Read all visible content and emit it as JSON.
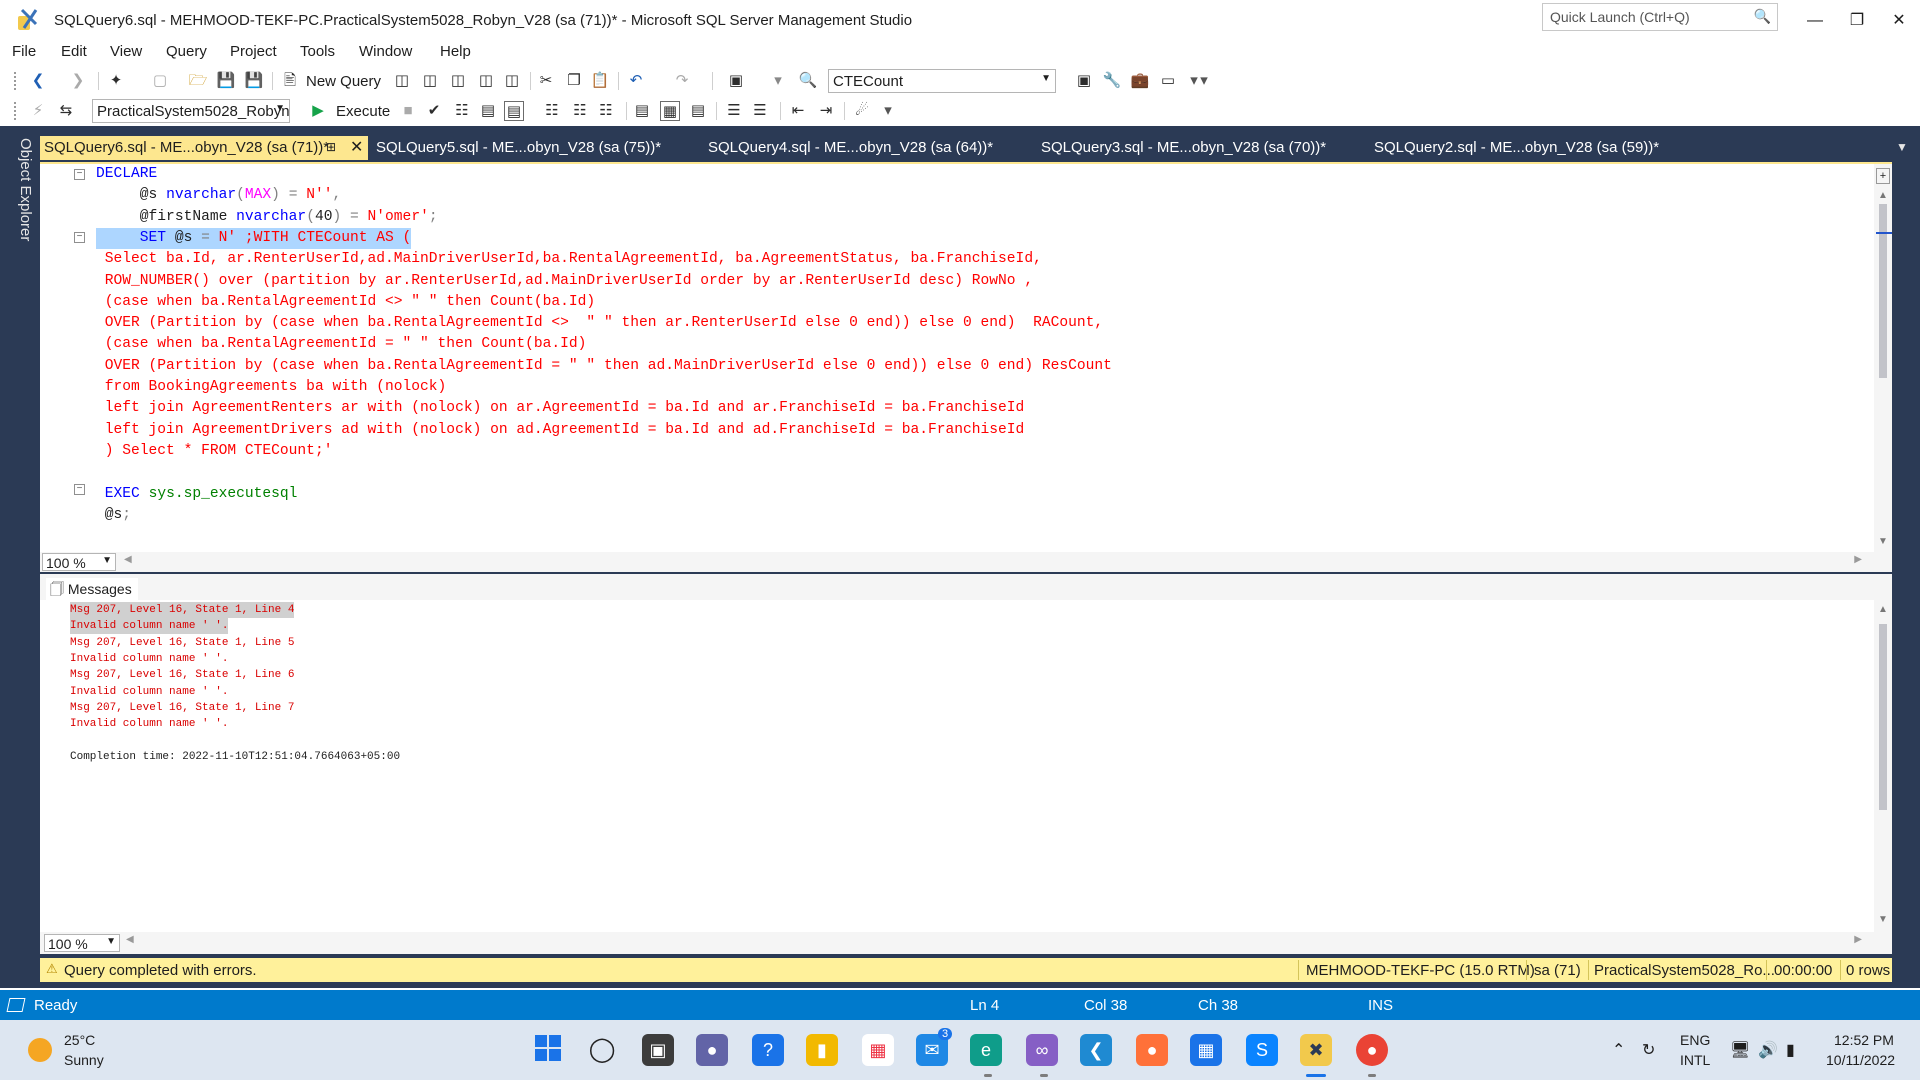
{
  "window": {
    "title": "SQLQuery6.sql - MEHMOOD-TEKF-PC.PracticalSystem5028_Robyn_V28 (sa (71))* - Microsoft SQL Server Management Studio",
    "quick_launch_placeholder": "Quick Launch (Ctrl+Q)",
    "icons": [
      "ssms-app-icon",
      "search-icon",
      "minimize-icon",
      "restore-icon",
      "close-icon"
    ]
  },
  "menu": [
    "File",
    "Edit",
    "View",
    "Query",
    "Project",
    "Tools",
    "Window",
    "Help"
  ],
  "toolbar1": {
    "new_query_label": "New Query",
    "find_combo_value": "CTECount"
  },
  "toolbar2": {
    "database_value": "PracticalSystem5028_Robyn",
    "execute_label": "Execute"
  },
  "side_panel": {
    "object_explorer_label": "Object Explorer"
  },
  "tabs": [
    {
      "label": "SQLQuery6.sql - ME...obyn_V28 (sa (71))*",
      "active": true
    },
    {
      "label": "SQLQuery5.sql - ME...obyn_V28 (sa (75))*",
      "active": false
    },
    {
      "label": "SQLQuery4.sql - ME...obyn_V28 (sa (64))*",
      "active": false
    },
    {
      "label": "SQLQuery3.sql - ME...obyn_V28 (sa (70))*",
      "active": false
    },
    {
      "label": "SQLQuery2.sql - ME...obyn_V28 (sa (59))*",
      "active": false
    }
  ],
  "editor": {
    "zoom": "100 %",
    "lines": [
      [
        [
          "kw",
          "DECLARE"
        ]
      ],
      [
        [
          "pl",
          "     @s "
        ],
        [
          "kw",
          "nvarchar"
        ],
        [
          "op",
          "("
        ],
        [
          "fn",
          "MAX"
        ],
        [
          "op",
          ")"
        ],
        [
          "pl",
          " "
        ],
        [
          "op",
          "="
        ],
        [
          "pl",
          " "
        ],
        [
          "str",
          "N''"
        ],
        [
          "op",
          ","
        ]
      ],
      [
        [
          "pl",
          "     @firstName "
        ],
        [
          "kw",
          "nvarchar"
        ],
        [
          "op",
          "("
        ],
        [
          "pl",
          "40"
        ],
        [
          "op",
          ")"
        ],
        [
          "pl",
          " "
        ],
        [
          "op",
          "="
        ],
        [
          "pl",
          " "
        ],
        [
          "str",
          "N'omer'"
        ],
        [
          "op",
          ";"
        ]
      ],
      [
        [
          "kw",
          "     SET"
        ],
        [
          "pl",
          " @s "
        ],
        [
          "op",
          "="
        ],
        [
          "pl",
          " "
        ],
        [
          "str",
          "N' ;WITH CTECount AS ("
        ]
      ],
      [
        [
          "str",
          " Select ba.Id, ar.RenterUserId,ad.MainDriverUserId,ba.RentalAgreementId, ba.AgreementStatus, ba.FranchiseId,"
        ]
      ],
      [
        [
          "str",
          " ROW_NUMBER() over (partition by ar.RenterUserId,ad.MainDriverUserId order by ar.RenterUserId desc) RowNo ,"
        ]
      ],
      [
        [
          "str",
          " (case when ba.RentalAgreementId <> \" \" then Count(ba.Id)"
        ]
      ],
      [
        [
          "str",
          " OVER (Partition by (case when ba.RentalAgreementId <>  \" \" then ar.RenterUserId else 0 end)) else 0 end)  RACount,"
        ]
      ],
      [
        [
          "str",
          " (case when ba.RentalAgreementId = \" \" then Count(ba.Id)"
        ]
      ],
      [
        [
          "str",
          " OVER (Partition by (case when ba.RentalAgreementId = \" \" then ad.MainDriverUserId else 0 end)) else 0 end) ResCount"
        ]
      ],
      [
        [
          "str",
          " from BookingAgreements ba with (nolock)"
        ]
      ],
      [
        [
          "str",
          " left join AgreementRenters ar with (nolock) on ar.AgreementId = ba.Id and ar.FranchiseId = ba.FranchiseId"
        ]
      ],
      [
        [
          "str",
          " left join AgreementDrivers ad with (nolock) on ad.AgreementId = ba.Id and ad.FranchiseId = ba.FranchiseId"
        ]
      ],
      [
        [
          "str",
          " ) Select * FROM CTECount;'"
        ]
      ],
      [
        [
          "pl",
          ""
        ]
      ],
      [
        [
          "kw",
          " EXEC"
        ],
        [
          "pl",
          " "
        ],
        [
          "sys",
          "sys.sp_executesql"
        ]
      ],
      [
        [
          "pl",
          " @s"
        ],
        [
          "op",
          ";"
        ]
      ]
    ]
  },
  "results": {
    "tab_label": "Messages",
    "zoom": "100 %",
    "messages": [
      {
        "text": "Msg 207, Level 16, State 1, Line 4",
        "kind": "err",
        "selected": true
      },
      {
        "text": "Invalid column name ' '.",
        "kind": "err",
        "selected": true
      },
      {
        "text": "Msg 207, Level 16, State 1, Line 5",
        "kind": "err",
        "selected": false
      },
      {
        "text": "Invalid column name ' '.",
        "kind": "err",
        "selected": false
      },
      {
        "text": "Msg 207, Level 16, State 1, Line 6",
        "kind": "err",
        "selected": false
      },
      {
        "text": "Invalid column name ' '.",
        "kind": "err",
        "selected": false
      },
      {
        "text": "Msg 207, Level 16, State 1, Line 7",
        "kind": "err",
        "selected": false
      },
      {
        "text": "Invalid column name ' '.",
        "kind": "err",
        "selected": false
      },
      {
        "text": "",
        "kind": "plain",
        "selected": false
      },
      {
        "text": "Completion time: 2022-11-10T12:51:04.7664063+05:00",
        "kind": "plain",
        "selected": false
      }
    ]
  },
  "query_status": {
    "message": "Query completed with errors.",
    "server": "MEHMOOD-TEKF-PC (15.0 RTM)",
    "user": "sa (71)",
    "database": "PracticalSystem5028_Ro...",
    "elapsed": "00:00:00",
    "rows": "0 rows"
  },
  "status_bar": {
    "state": "Ready",
    "ln": "Ln 4",
    "col": "Col 38",
    "ch": "Ch 38",
    "mode": "INS"
  },
  "taskbar": {
    "temperature": "25°C",
    "weather": "Sunny",
    "teams_badge": "3",
    "language": "ENG",
    "layout": "INTL",
    "time": "12:52 PM",
    "date": "10/11/2022"
  },
  "colors": {
    "frame": "#2b3a55",
    "active_tab": "#fde78f",
    "status_bar": "#007acc",
    "query_status_bar": "#fff19b",
    "keyword": "#0000ff",
    "string": "#ff0000",
    "error_text": "#d90000"
  }
}
